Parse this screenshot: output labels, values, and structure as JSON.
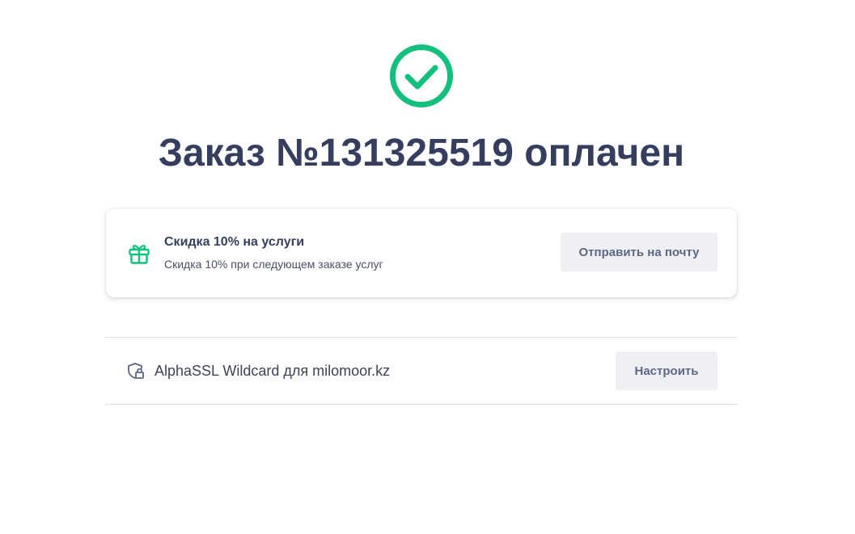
{
  "colors": {
    "success": "#13c07e",
    "title": "#353e5e",
    "button_bg": "#eef0f4",
    "button_text": "#5d6785",
    "divider": "#dcdee4"
  },
  "status": {
    "icon": "check-circle-icon",
    "title": "Заказ №131325519 оплачен"
  },
  "promo": {
    "icon": "gift-icon",
    "title": "Скидка 10% на услуги",
    "subtitle": "Скидка 10% при следующем заказе услуг",
    "send_button_label": "Отправить на почту"
  },
  "products": [
    {
      "icon": "shield-lock-icon",
      "name": "AlphaSSL Wildcard для milomoor.kz",
      "configure_button_label": "Настроить"
    }
  ]
}
